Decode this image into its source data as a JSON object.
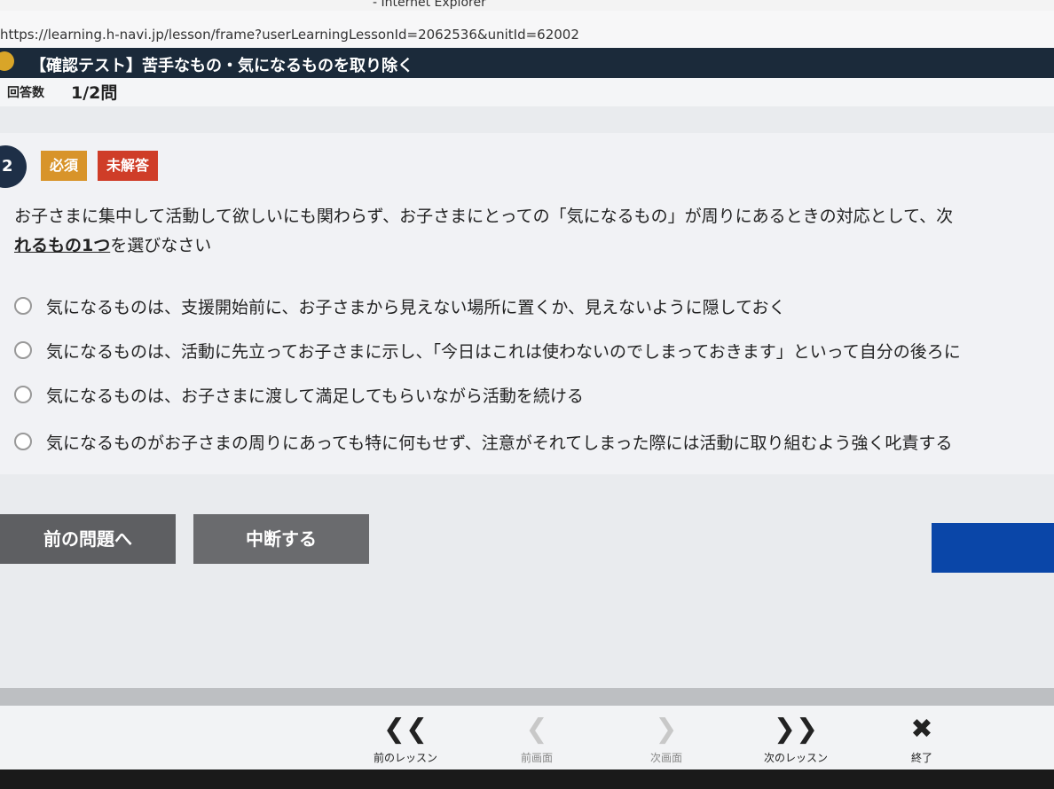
{
  "browser": {
    "window_title": "- Internet Explorer",
    "url": "https://learning.h-navi.jp/lesson/frame?userLearningLessonId=2062536&unitId=62002"
  },
  "header": {
    "title": "【確認テスト】苦手なもの・気になるものを取り除く"
  },
  "answer_count": {
    "label": "回答数",
    "value": "1/2問"
  },
  "question": {
    "number": "2",
    "tag_required": "必須",
    "tag_unanswered": "未解答",
    "text_line1": "お子さまに集中して活動して欲しいにも関わらず、お子さまにとっての「気になるもの」が周りにあるときの対応として、次",
    "text_emphasis": "れるもの1つ",
    "text_line2_rest": "を選びなさい",
    "options": [
      "気になるものは、支援開始前に、お子さまから見えない場所に置くか、見えないように隠しておく",
      "気になるものは、活動に先立ってお子さまに示し、「今日はこれは使わないのでしまっておきます」といって自分の後ろに",
      "気になるものは、お子さまに渡して満足してもらいながら活動を続ける",
      "気になるものがお子さまの周りにあっても特に何もせず、注意がそれてしまった際には活動に取り組むよう強く叱責する"
    ]
  },
  "buttons": {
    "prev_question": "前の問題へ",
    "pause": "中断する",
    "next": ""
  },
  "footer": {
    "prev_lesson": "前のレッスン",
    "prev_screen": "前画面",
    "next_screen": "次画面",
    "next_lesson": "次のレッスン",
    "end": "終了",
    "prev_lesson_icon": "double-chevron-left-icon",
    "prev_screen_icon": "chevron-left-icon",
    "next_screen_icon": "chevron-right-icon",
    "next_lesson_icon": "double-chevron-right-icon",
    "end_icon": "close-icon"
  },
  "colors": {
    "header_bg": "#1b2a3a",
    "tag_required": "#d8942a",
    "tag_unanswered": "#cf3d28",
    "next_button": "#0a46a8"
  }
}
